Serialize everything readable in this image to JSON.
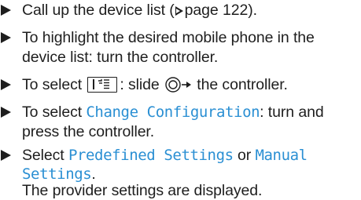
{
  "instructions": {
    "item1": {
      "text_before": "Call up the device list (",
      "page_ref": "page 122",
      "text_after": ")."
    },
    "item2": {
      "line1": "To highlight the desired mobile phone in the",
      "line2": "device list: turn the controller."
    },
    "item3": {
      "text_before": "To select",
      "text_mid": ": slide",
      "text_after": "the controller."
    },
    "item4": {
      "text_before": "To select",
      "menu_option": "Change Configuration",
      "text_after": ": turn and",
      "line2": "press the controller."
    },
    "item5": {
      "text_before": "Select",
      "option_a_line1": "Predefined Settings",
      "text_or": "or",
      "option_b_line1": "Manual",
      "option_b_line2": "Settings",
      "text_after": ".",
      "result": "The provider settings are displayed."
    }
  },
  "icons": {
    "bullet": "bullet-triangle-icon",
    "page_reference": "page-reference-triangle-icon",
    "menu_key": "menu-key-icon",
    "controller_slide": "controller-slide-icon"
  },
  "colors": {
    "text": "#1e1e1e",
    "highlight": "#2a8fd3",
    "background": "#ffffff"
  }
}
